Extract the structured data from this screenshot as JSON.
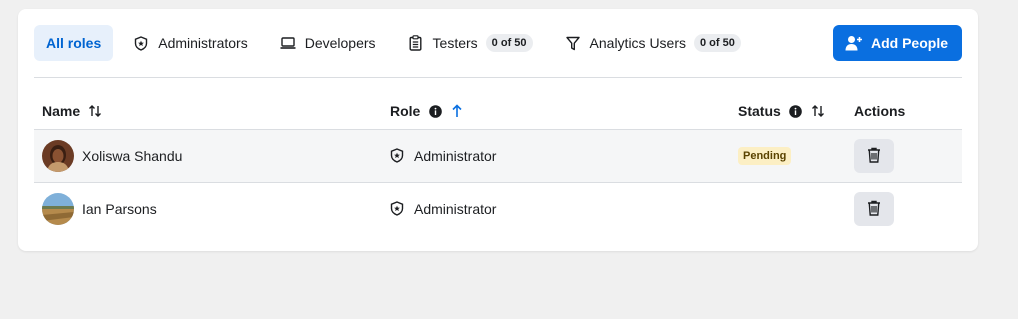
{
  "tabs": [
    {
      "label": "All roles",
      "icon": "none",
      "badge": ""
    },
    {
      "label": "Administrators",
      "icon": "shield-icon",
      "badge": ""
    },
    {
      "label": "Developers",
      "icon": "laptop-icon",
      "badge": ""
    },
    {
      "label": "Testers",
      "icon": "clipboard-icon",
      "badge": "0 of 50"
    },
    {
      "label": "Analytics Users",
      "icon": "filter-icon",
      "badge": "0 of 50"
    }
  ],
  "add_button_label": "Add People",
  "table": {
    "headers": {
      "name": "Name",
      "role": "Role",
      "status": "Status",
      "actions": "Actions"
    },
    "rows": [
      {
        "name": "Xoliswa Shandu",
        "role": "Administrator",
        "status": "Pending"
      },
      {
        "name": "Ian Parsons",
        "role": "Administrator",
        "status": ""
      }
    ]
  },
  "colors": {
    "accent": "#0a6fe0",
    "active_tab_bg": "#e7f0fb",
    "pending_bg": "#fcefc4"
  }
}
